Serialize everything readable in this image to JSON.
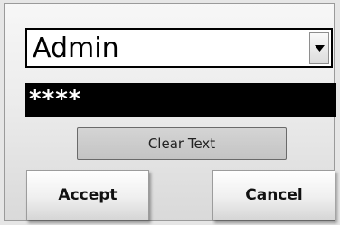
{
  "login": {
    "user_select": {
      "selected": "Admin"
    },
    "password_field": {
      "masked_value": "****"
    },
    "clear_text_label": "Clear Text",
    "accept_label": "Accept",
    "cancel_label": "Cancel"
  },
  "icons": {
    "dropdown": "chevron-down-icon"
  },
  "colors": {
    "panel_background": "#ececec",
    "password_background": "#000000",
    "password_text": "#ffffff"
  }
}
